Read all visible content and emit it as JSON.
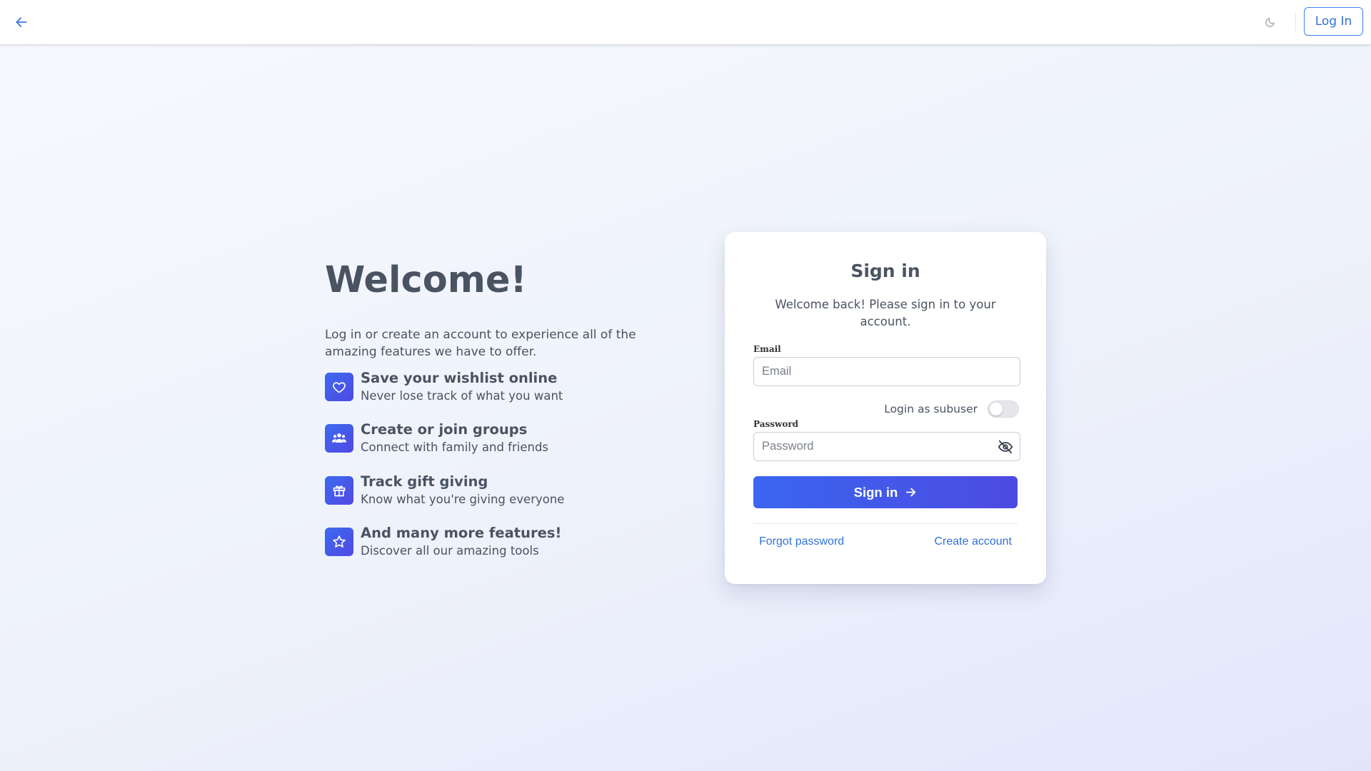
{
  "header": {
    "back_icon": "arrow-left-icon",
    "theme_icon": "moon-icon",
    "login_label": "Log In"
  },
  "intro": {
    "title": "Welcome!",
    "description": "Log in or create an account to experience all of the amazing features we have to offer.",
    "features": [
      {
        "icon": "heart-icon",
        "title": "Save your wishlist online",
        "subtitle": "Never lose track of what you want"
      },
      {
        "icon": "users-icon",
        "title": "Create or join groups",
        "subtitle": "Connect with family and friends"
      },
      {
        "icon": "gift-icon",
        "title": "Track gift giving",
        "subtitle": "Know what you're giving everyone"
      },
      {
        "icon": "star-icon",
        "title": "And many more features!",
        "subtitle": "Discover all our amazing tools"
      }
    ]
  },
  "signin": {
    "title": "Sign in",
    "subtitle": "Welcome back! Please sign in to your account.",
    "email_label": "Email",
    "email_placeholder": "Email",
    "email_value": "",
    "subuser_label": "Login as subuser",
    "subuser_enabled": false,
    "password_label": "Password",
    "password_placeholder": "Password",
    "password_value": "",
    "submit_label": "Sign in",
    "forgot_label": "Forgot password",
    "create_label": "Create account"
  },
  "colors": {
    "accent": "#3b82f6",
    "button_gradient_start": "#3a66f0",
    "button_gradient_end": "#4d4ae2",
    "text": "#4a5361"
  }
}
